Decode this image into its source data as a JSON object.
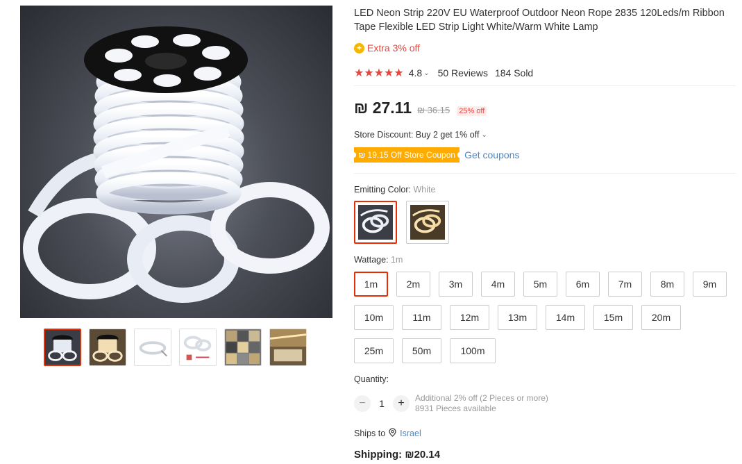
{
  "product": {
    "title": "LED Neon Strip 220V EU Waterproof Outdoor Neon Rope 2835 120Leds/m Ribbon Tape Flexible LED Strip Light White/Warm White Lamp",
    "extra_badge_icon": "+",
    "extra_text": "Extra 3% off",
    "stars_icon": "star-icon",
    "stars": "★★★★★",
    "rating": "4.8",
    "rating_chevron": "⌄",
    "reviews": "50 Reviews",
    "sold": "184 Sold"
  },
  "price": {
    "current": "₪ 27.11",
    "original": "₪ 36.15",
    "discount": "25% off"
  },
  "store": {
    "discount_text": "Store Discount: Buy 2 get 1% off",
    "discount_chevron": "⌄",
    "coupon_label": "₪ 19.15 Off Store Coupon",
    "get_coupons": "Get coupons"
  },
  "color": {
    "label": "Emitting Color: ",
    "selected": "White",
    "options": [
      "White",
      "Warm White"
    ]
  },
  "wattage": {
    "label": "Wattage: ",
    "selected": "1m",
    "options": [
      "1m",
      "2m",
      "3m",
      "4m",
      "5m",
      "6m",
      "7m",
      "8m",
      "9m",
      "10m",
      "11m",
      "12m",
      "13m",
      "14m",
      "15m",
      "20m",
      "25m",
      "50m",
      "100m"
    ]
  },
  "quantity": {
    "label": "Quantity:",
    "minus": "−",
    "value": "1",
    "plus": "+",
    "note_line1": "Additional 2% off (2 Pieces or more)",
    "note_line2": "8931 Pieces available"
  },
  "shipping": {
    "ships_to_label": "Ships to",
    "location_icon": "location-pin-icon",
    "country": "Israel",
    "shipping_label": "Shipping: ₪20.14"
  },
  "colors": {
    "accent": "#e62e04",
    "star": "#e8453c",
    "coupon": "#ffab00",
    "link": "#4a86c4"
  }
}
